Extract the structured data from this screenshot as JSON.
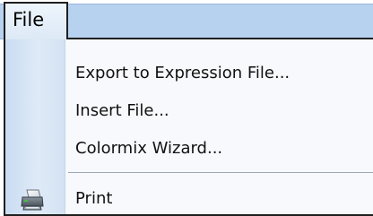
{
  "menubar": {
    "file_label": "File"
  },
  "menu": {
    "items": [
      {
        "label": "Export to Expression File...",
        "icon": null
      },
      {
        "label": "Insert File...",
        "icon": null
      },
      {
        "label": "Colormix Wizard...",
        "icon": null
      },
      {
        "label": "Print",
        "icon": "printer-icon"
      }
    ]
  },
  "colors": {
    "menubar_bg": "#b7d2ef",
    "icon_strip": "#c9dcf2",
    "menu_bg": "#f7f9fc",
    "border": "#1f1f1f"
  }
}
